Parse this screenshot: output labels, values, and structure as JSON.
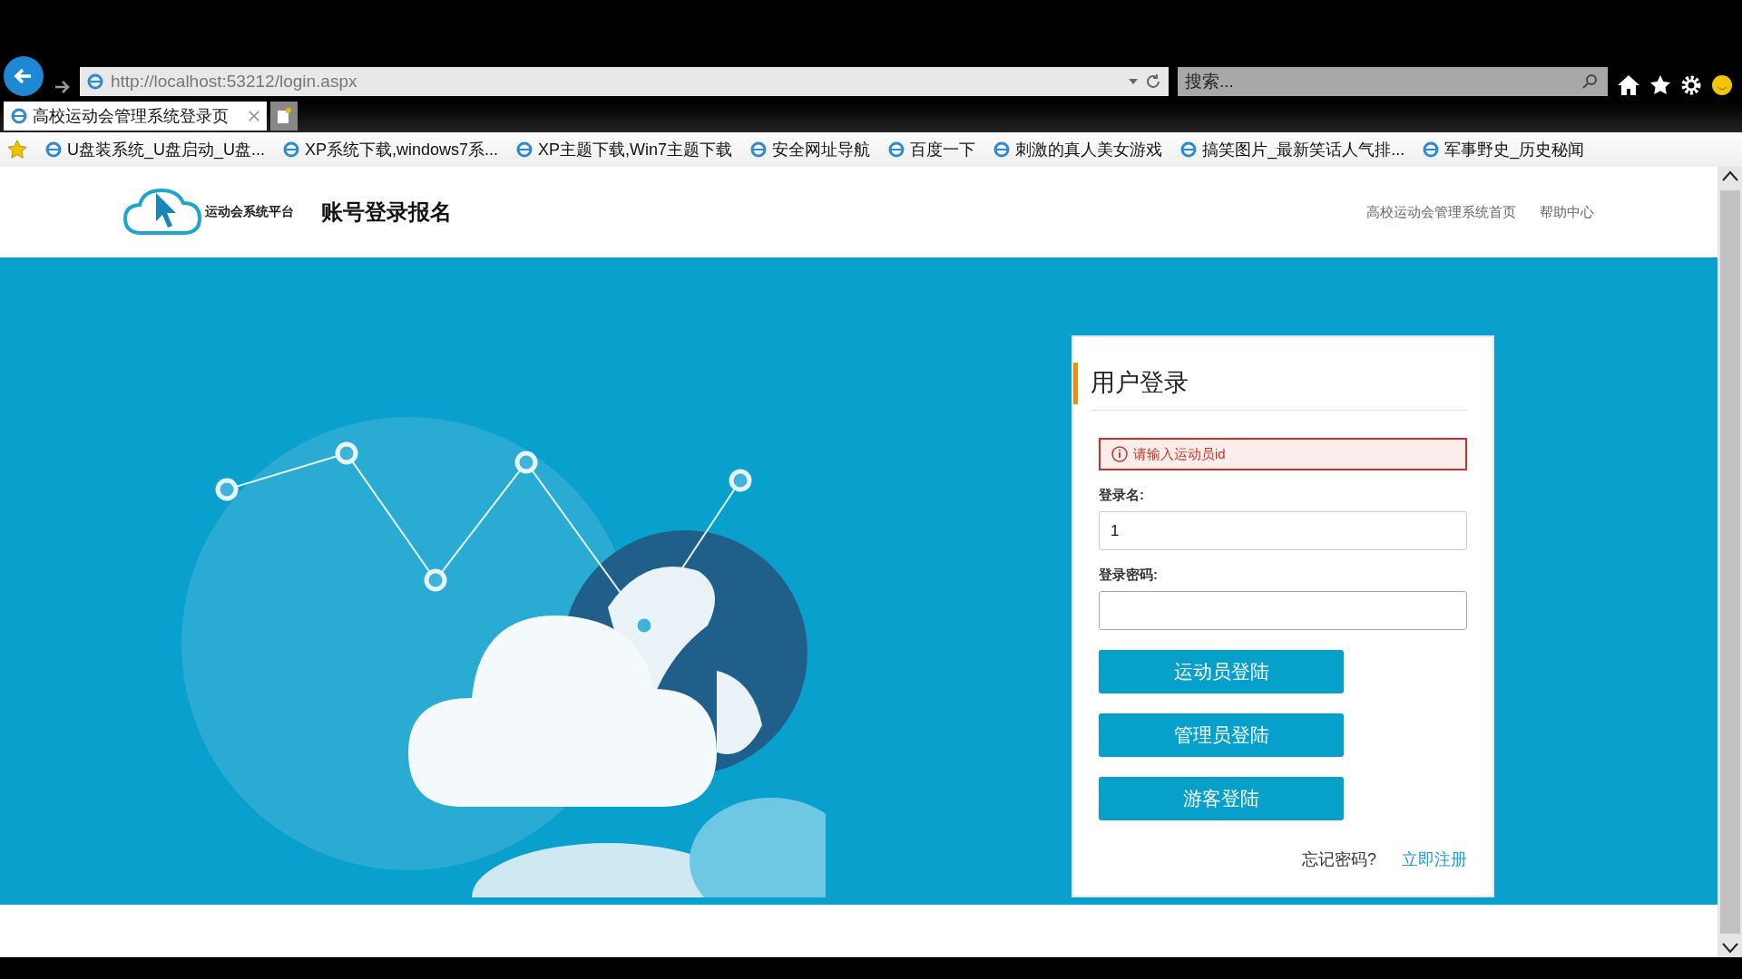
{
  "browser": {
    "address": "http://localhost:53212/login.aspx",
    "search": {
      "placeholder": "搜索..."
    },
    "tabs": [
      {
        "label": "高校运动会管理系统登录页",
        "selected": true
      }
    ],
    "bookmarks": [
      "U盘装系统_U盘启动_U盘...",
      "XP系统下载,windows7系...",
      "XP主题下载,Win7主题下载",
      "安全网址导航",
      "百度一下",
      "刺激的真人美女游戏",
      "搞笑图片_最新笑话人气排...",
      "军事野史_历史秘闻"
    ]
  },
  "header": {
    "logo_text": "运动会系统平台",
    "title": "账号登录报名",
    "nav": [
      "高校运动会管理系统首页",
      "帮助中心"
    ]
  },
  "login": {
    "title": "用户登录",
    "error": "请输入运动员id",
    "fields": [
      {
        "label": "登录名:",
        "value": "1",
        "focused": false
      },
      {
        "label": "登录密码:",
        "focused": true
      }
    ],
    "buttons": [
      "运动员登陆",
      "管理员登陆",
      "游客登陆"
    ],
    "forgot": "忘记密码?",
    "register": "立即注册"
  }
}
